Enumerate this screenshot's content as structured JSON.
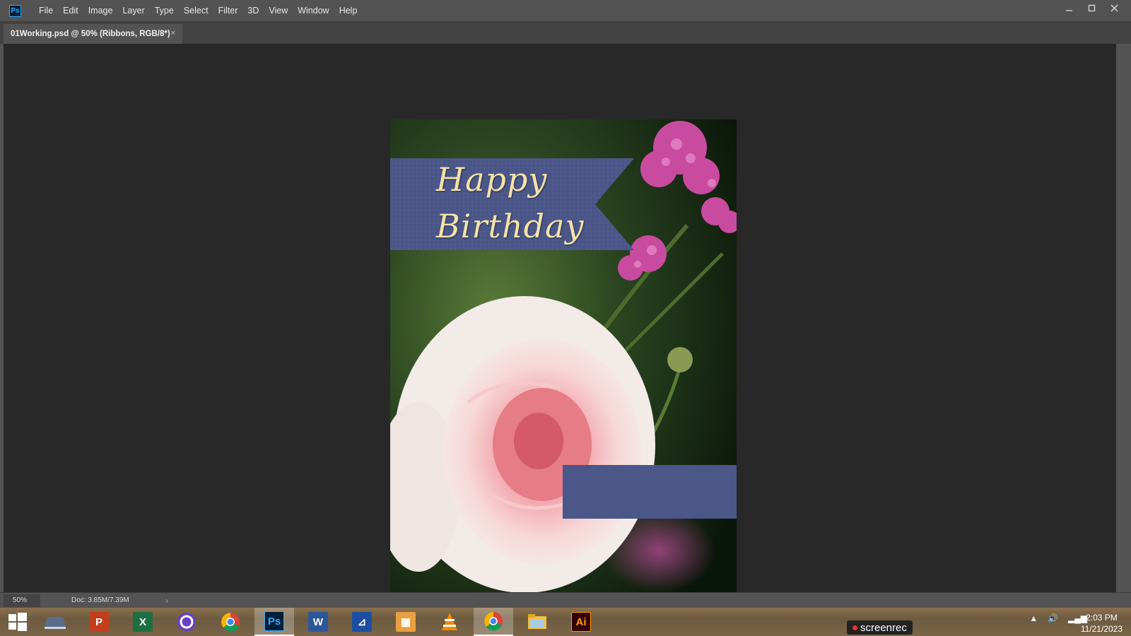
{
  "app": {
    "logo": "Ps"
  },
  "menu": [
    "File",
    "Edit",
    "Image",
    "Layer",
    "Type",
    "Select",
    "Filter",
    "3D",
    "View",
    "Window",
    "Help"
  ],
  "document_tab": {
    "title": "01Working.psd @ 50% (Ribbons, RGB/8*)",
    "close": "×"
  },
  "canvas": {
    "ribbon_line1": "Happy",
    "ribbon_line2": "Birthday"
  },
  "status": {
    "zoom": "50%",
    "doc": "Doc: 3.85M/7.39M",
    "arrow": "›"
  },
  "taskbar": {
    "apps": [
      "windows-start",
      "laptop",
      "powerpoint",
      "excel",
      "cortana",
      "chrome",
      "photoshop",
      "word",
      "scanner",
      "presentation",
      "vlc",
      "chrome-profile",
      "file-explorer",
      "illustrator"
    ],
    "active": "photoshop",
    "screenrec": "screenrec",
    "time": "2:03 PM",
    "date": "11/21/2023"
  },
  "colors": {
    "ribbon": "#4b5689",
    "text": "#f4e3a8",
    "ps_blue": "#31a8ff"
  }
}
